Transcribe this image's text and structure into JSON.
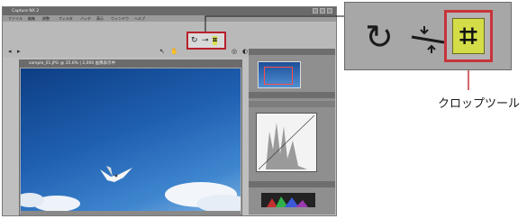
{
  "app": {
    "title": "Capture NX 2",
    "menu": [
      "ファイル",
      "編集",
      "調整",
      "フィルタ",
      "バッチ",
      "表示",
      "ウィンドウ",
      "ヘルプ"
    ]
  },
  "image_window": {
    "title": "sample_01.JPG @ 35.6% | 2,000 画像表示中"
  },
  "callout": {
    "label": "クロップツール",
    "tools": [
      "rotate-icon",
      "white-balance-icon",
      "crop-icon"
    ]
  },
  "colors": {
    "highlight": "#c7343a",
    "crop_bg": "#d4dd48",
    "sky_top": "#0d3e84",
    "sky_bottom": "#7eb0e0"
  }
}
